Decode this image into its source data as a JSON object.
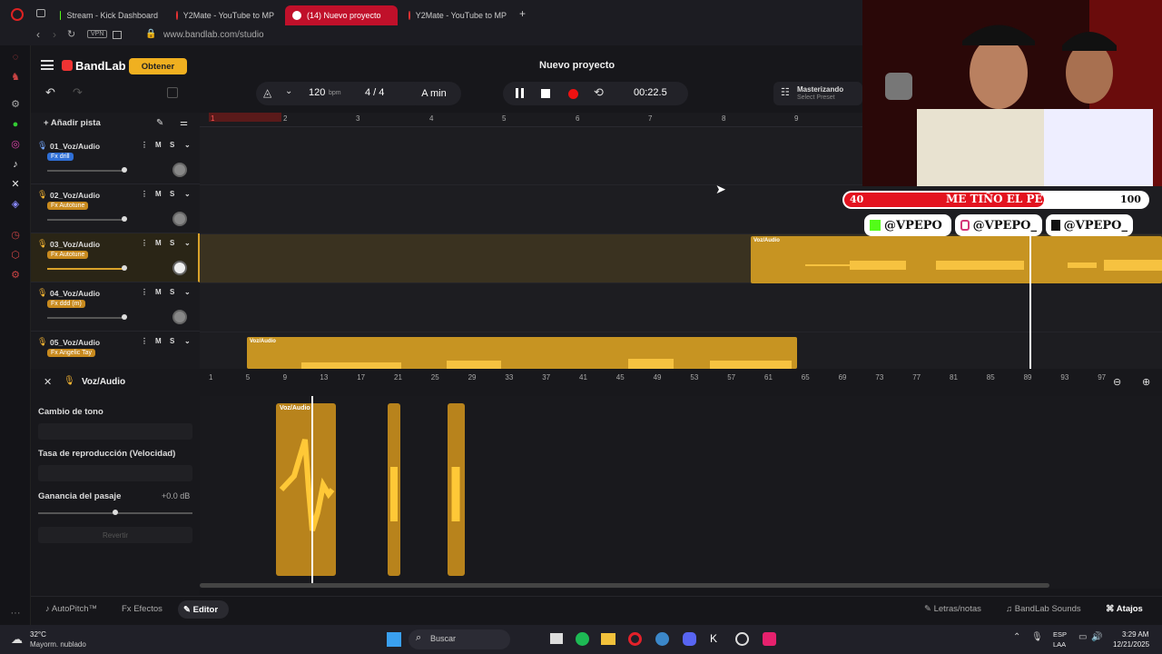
{
  "browser": {
    "tabs": [
      {
        "label": "Stream - Kick Dashboard",
        "active": false
      },
      {
        "label": "Y2Mate - YouTube to MP",
        "active": false
      },
      {
        "label": "(14) Nuevo proyecto",
        "active": true
      },
      {
        "label": "Y2Mate - YouTube to MP",
        "active": false
      }
    ],
    "new_tab": "+",
    "url": "www.bandlab.com/studio",
    "vpn": "VPN"
  },
  "app": {
    "logo": "BandLab",
    "get_button": "Obtener",
    "project_title": "Nuevo proyecto",
    "bpm": "120",
    "bpm_unit": "bpm",
    "time_signature": "4 / 4",
    "key": "A min",
    "time": "00:22.5",
    "mastering_label": "Masterizando",
    "mastering_preset": "Select Preset",
    "add_track": "Añadir pista"
  },
  "ruler": {
    "top_ticks": [
      "1",
      "2",
      "3",
      "4",
      "5",
      "6",
      "7",
      "8",
      "9"
    ],
    "bottom_ticks": [
      "1",
      "5",
      "9",
      "13",
      "17",
      "21",
      "25",
      "29",
      "33",
      "37",
      "41",
      "45",
      "49",
      "53",
      "57",
      "61",
      "65",
      "69",
      "73",
      "77",
      "81",
      "85",
      "89",
      "93",
      "97"
    ]
  },
  "tracks": [
    {
      "name": "01_Voz/Audio",
      "fx": "Fx drill",
      "fx_color": "#2f6fd6"
    },
    {
      "name": "02_Voz/Audio",
      "fx": "Fx Autotune",
      "fx_color": "#c88a1e"
    },
    {
      "name": "03_Voz/Audio",
      "fx": "Fx Autotune",
      "fx_color": "#c88a1e"
    },
    {
      "name": "04_Voz/Audio",
      "fx": "Fx ddd (m)",
      "fx_color": "#c88a1e"
    },
    {
      "name": "05_Voz/Audio",
      "fx": "Fx Angelic Tay",
      "fx_color": "#c88a1e"
    }
  ],
  "track_controls": {
    "mute": "M",
    "solo": "S"
  },
  "clips": {
    "label": "Voz/Audio"
  },
  "editor": {
    "title": "Voz/Audio",
    "pitch_label": "Cambio de tono",
    "rate_label": "Tasa de reproducción (Velocidad)",
    "gain_label": "Ganancia del pasaje",
    "gain_value": "+0.0 dB",
    "revert": "Revertir"
  },
  "bottom_bar": {
    "autopitch": "AutoPitch™",
    "effects": "Efectos",
    "editor": "Editor",
    "lyrics": "Letras/notas",
    "sounds": "BandLab Sounds",
    "shortcuts": "Atajos"
  },
  "overlay": {
    "goal_left": "40",
    "goal_text": "ME TIÑO EL PELO",
    "goal_right": "100",
    "kick": "@VPEPO",
    "instagram": "@VPEPO_",
    "tiktok": "@VPEPO_"
  },
  "taskbar": {
    "temperature": "32°C",
    "weather": "Mayorm. nublado",
    "search": "Buscar",
    "lang": "ESP",
    "lang2": "LAA",
    "clock_time": "3:29 AM",
    "clock_date": "12/21/2025"
  }
}
